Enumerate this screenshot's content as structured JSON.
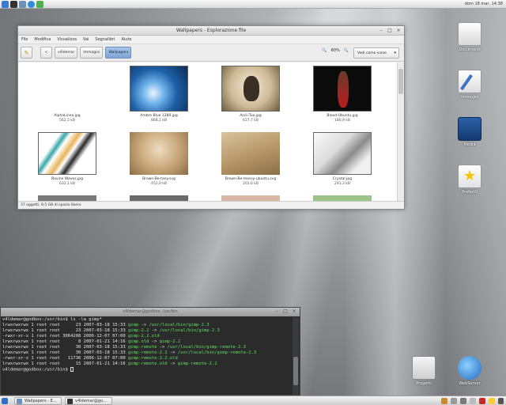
{
  "top_panel": {
    "clock": "dom 18 mar, 14:38",
    "icons": [
      "kde-menu-icon",
      "terminal-icon",
      "folder-icon",
      "browser-icon",
      "paint-icon"
    ]
  },
  "fm_window": {
    "title": "Wallpapers - Esplorazione file",
    "menu": [
      "File",
      "Modifica",
      "Visualizza",
      "Vai",
      "Segnalibri",
      "Aiuto"
    ],
    "toolbar": {
      "back": "<",
      "crumbs": [
        "v4ldemar",
        "Immagini",
        "Wallpapers"
      ],
      "zoom": "60%",
      "view_mode": "Vedi come icone"
    },
    "files": [
      {
        "name": "AlphaLinea.jpg",
        "size": "562,5 kB"
      },
      {
        "name": "Ambre Blue 1280.jpg",
        "size": "868,1 kB"
      },
      {
        "name": "Ascii-Tux.jpg",
        "size": "637,7 kB"
      },
      {
        "name": "Blood-Ubuntu.jpg",
        "size": "180,9 kB"
      },
      {
        "name": "Bovine Waves.jpg",
        "size": "632,1 kB"
      },
      {
        "name": "Brown-Be-tany.svg",
        "size": "452,9 kB"
      },
      {
        "name": "Brown-Be-messy-ubuntu.svg",
        "size": "202,6 kB"
      },
      {
        "name": "Crystal.jpg",
        "size": "291,3 kB"
      }
    ],
    "status": "37 oggetti, 9,5 GB di spazio libero"
  },
  "desktop_icons": [
    {
      "label": "Documenti",
      "icon": "documents-icon"
    },
    {
      "label": "Immagini",
      "icon": "images-icon"
    },
    {
      "label": "Media",
      "icon": "media-icon"
    },
    {
      "label": "Preferiti",
      "icon": "favorites-icon"
    },
    {
      "label": "Progetti",
      "icon": "projects-icon"
    },
    {
      "label": "WebServer",
      "icon": "webserver-icon"
    }
  ],
  "terminal": {
    "title": "v4ldemar@godbox: /usr/bin",
    "lines": [
      {
        "prefix": "v4ldemar@godbox:/usr/bin$ ls -la gimp*",
        "name": "",
        "arrow": "",
        "target": ""
      },
      {
        "prefix": "lrwxrwxrwx 1 root root      23 2007-03-18 15:33 ",
        "name": "gimp",
        "arrow": " -> ",
        "target": "/usr/local/bin/gimp-2.3"
      },
      {
        "prefix": "lrwxrwxrwx 1 root root      23 2007-03-18 15:33 ",
        "name": "gimp-2.2",
        "arrow": " -> ",
        "target": "/usr/local/bin/gimp-2.3"
      },
      {
        "prefix": "-rwxr-xr-x 1 root root 3064208 2006-12-07 07:00 ",
        "name": "gimp-2.2.old",
        "arrow": "",
        "target": ""
      },
      {
        "prefix": "lrwxrwxrwx 1 root root       8 2007-01-21 14:16 ",
        "name": "gimp.old",
        "arrow": " -> ",
        "target": "gimp-2.2"
      },
      {
        "prefix": "lrwxrwxrwx 1 root root      30 2007-03-18 15:33 ",
        "name": "gimp-remote",
        "arrow": " -> ",
        "target": "/usr/local/bin/gimp-remote-2.3"
      },
      {
        "prefix": "lrwxrwxrwx 1 root root      30 2007-03-18 15:33 ",
        "name": "gimp-remote-2.2",
        "arrow": " -> ",
        "target": "/usr/local/bin/gimp-remote-2.3"
      },
      {
        "prefix": "-rwxr-xr-x 1 root root   11736 2006-12-07 07:00 ",
        "name": "gimp-remote-2.2.old",
        "arrow": "",
        "target": ""
      },
      {
        "prefix": "lrwxrwxrwx 1 root root      15 2007-01-21 14:16 ",
        "name": "gimp-remote.old",
        "arrow": " -> ",
        "target": "gimp-remote-2.2"
      },
      {
        "prefix": "v4ldemar@godbox:/usr/bin$ ",
        "name": "",
        "arrow": "",
        "target": ""
      }
    ]
  },
  "taskbar": {
    "tasks": [
      "Wallpapers - E...",
      "v4ldemar@go..."
    ]
  },
  "colors": {
    "accent": "#7ea4d6",
    "terminal_green": "#5fe05f",
    "terminal_bg": "#2b2b2b"
  }
}
